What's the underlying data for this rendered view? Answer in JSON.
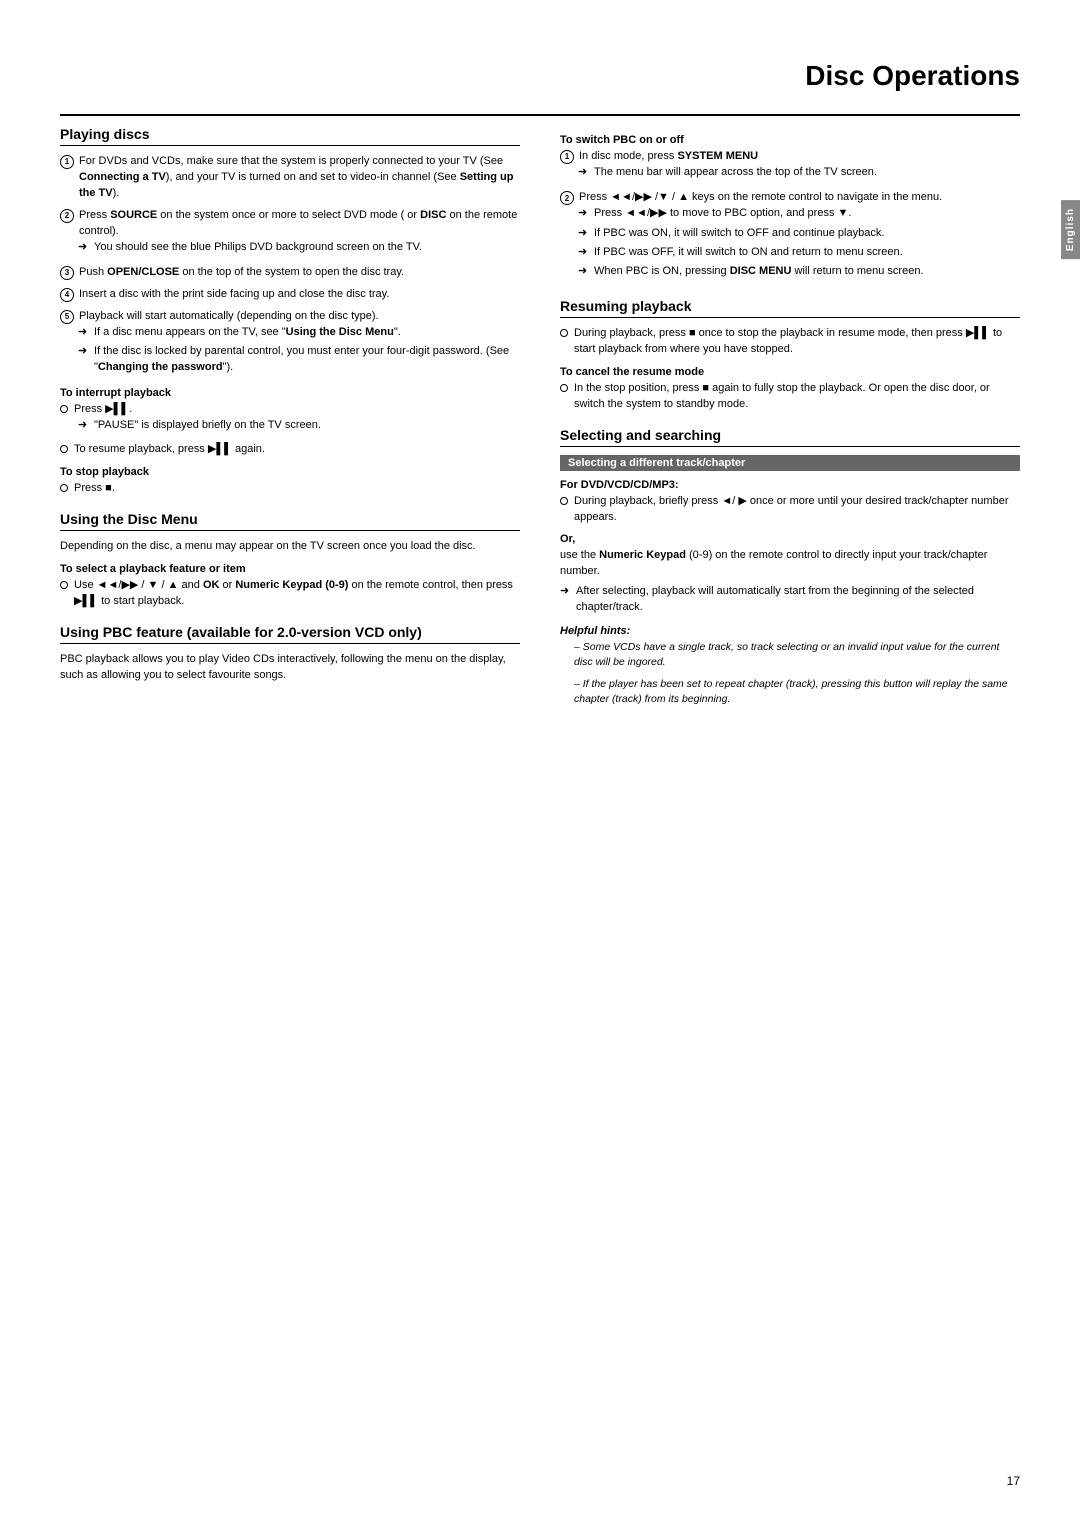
{
  "page": {
    "title": "Disc Operations",
    "page_number": "17",
    "lang_tab": "English"
  },
  "left_col": {
    "playing_discs": {
      "title": "Playing discs",
      "items": [
        {
          "num": "1",
          "text": "For DVDs and VCDs, make sure that the system is properly connected to your TV (See ",
          "bold1": "Connecting a TV",
          "text2": "), and your TV is turned on and set to video-in channel (See ",
          "bold2": "Setting up the TV",
          "text3": ")."
        },
        {
          "num": "2",
          "text": "Press ",
          "bold1": "SOURCE",
          "text2": " on the system once or more to select DVD mode ( or ",
          "bold2": "DISC",
          "text3": " on the remote control).",
          "arrow": "You should see the blue Philips DVD background screen on the TV."
        },
        {
          "num": "3",
          "text": "Push ",
          "bold1": "OPEN/CLOSE",
          "text2": " on the top of the system to open the disc tray."
        },
        {
          "num": "4",
          "text": "Insert a disc with the print side facing up and close the disc tray."
        },
        {
          "num": "5",
          "text": "Playback will start automatically (depending on the disc type).",
          "arrows": [
            "If a disc menu appears on the TV, see “Using the Disc Menu”.",
            "If the disc is locked by parental control, you must enter your four-digit password. (See “Changing the password”)."
          ]
        }
      ],
      "interrupt_label": "To interrupt playback",
      "interrupt_items": [
        {
          "text": "Press ►▌▌.",
          "arrow": "“PAUSE” is displayed briefly on the TV screen."
        },
        {
          "text": "To resume playback, press ►▌▌ again."
        }
      ],
      "stop_label": "To stop playback",
      "stop_items": [
        {
          "text": "Press ■."
        }
      ]
    },
    "disc_menu": {
      "title": "Using the Disc Menu",
      "intro": "Depending on the disc, a menu may appear on the TV screen once you load the disc.",
      "select_label": "To select a playback feature or item",
      "select_items": [
        {
          "text": "Use ◄◄/►► / ▼ / ▲ and OK or Numeric Keypad (0-9) on the remote control, then press ►▌▌ to start playback."
        }
      ]
    },
    "pbc": {
      "title": "Using PBC feature (available for 2.0-version VCD only)",
      "intro": "PBC playback allows you to play Video CDs interactively, following the menu on the display, such as allowing you to select favourite songs."
    }
  },
  "right_col": {
    "switch_pbc": {
      "label": "To switch PBC on or off",
      "items": [
        {
          "num": "1",
          "text": "In disc mode, press ",
          "bold": "SYSTEM MENU",
          "arrow": "The menu bar will appear across the top of the TV screen."
        },
        {
          "num": "2",
          "text": "Press ◄◄/►► /▼ / ▲ keys on the remote control to navigate in the menu.",
          "arrows": [
            "Press ◄◄/►► to move to PBC option, and press ▼.",
            "If PBC was ON, it will switch to OFF and continue playback.",
            "If PBC was OFF, it will switch to ON and return to menu screen.",
            "When PBC is ON, pressing DISC MENU will return to menu screen."
          ],
          "arrow_bold": "DISC MENU"
        }
      ]
    },
    "resuming": {
      "title": "Resuming playback",
      "items": [
        {
          "text": "During playback, press ■ once to stop the playback in resume mode, then press ►▌▌ to start playback from where you have stopped."
        }
      ],
      "cancel_label": "To cancel the resume mode",
      "cancel_items": [
        {
          "text": "In the stop position, press ■ again to fully stop the playback. Or open the disc door, or switch the system to standby mode."
        }
      ]
    },
    "selecting": {
      "title": "Selecting and searching",
      "highlight": "Selecting a different track/chapter",
      "dvd_label": "For DVD/VCD/CD/MP3:",
      "dvd_items": [
        {
          "text": "During playback, briefly press ◄/ ► once or more until your desired track/chapter number appears."
        }
      ],
      "or_label": "Or,",
      "or_text": "use the Numeric Keypad (0-9) on the remote control to directly input your track/chapter number.",
      "or_arrow": "After selecting, playback will automatically start from the beginning of the selected chapter/track.",
      "hints_label": "Helpful hints:",
      "hint1": "–  Some VCDs have a single track, so track selecting or an invalid input value for the current disc will be ingored.",
      "hint2": "–  If the player has been set to repeat chapter (track), pressing this button will replay the same chapter (track) from its beginning."
    }
  }
}
